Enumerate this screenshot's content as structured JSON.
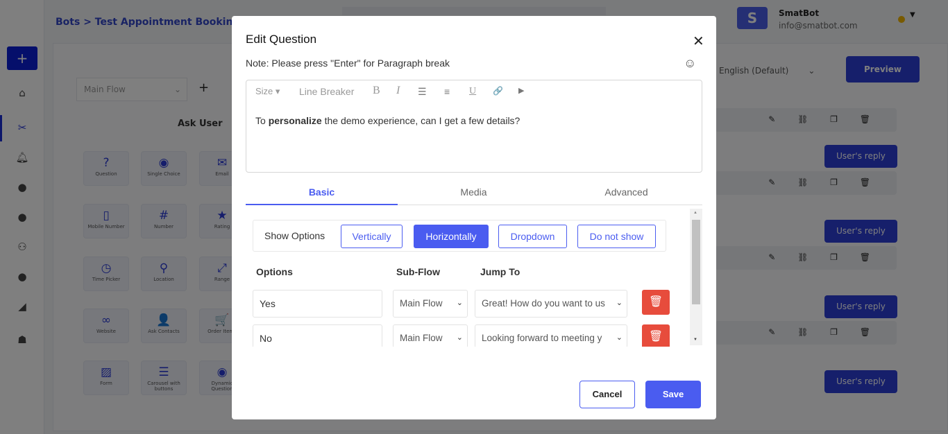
{
  "background": {
    "breadcrumb": "Bots > Test Appointment Booking > S",
    "flow_select": "Main Flow",
    "section_title": "Ask User",
    "tiles": [
      "Question",
      "Single Choice",
      "Email",
      "Mobile Number",
      "Number",
      "Rating",
      "Time Picker",
      "Location",
      "Range",
      "Website",
      "Ask Contacts",
      "Order Items",
      "Form",
      "Carousel with buttons",
      "Dynamic Question"
    ],
    "tile_icons": [
      "?",
      "◉",
      "✉",
      "▯",
      "#",
      "★",
      "◷",
      "⚲",
      "⤢",
      "∞",
      "👤",
      "🛒",
      "▨",
      "☰",
      "◉"
    ],
    "profile": {
      "initial": "S",
      "name": "SmatBot",
      "email": "info@smatbot.com"
    },
    "language": "English (Default)",
    "preview": "Preview",
    "reply_label": "User's reply",
    "row_icons": "✎ ⛓ ❐ 🗑"
  },
  "modal": {
    "title": "Edit Question",
    "note": "Note: Please press \"Enter\" for Paragraph break",
    "toolbar": {
      "size": "Size ▾",
      "line_breaker": "Line Breaker",
      "bold": "B",
      "italic": "I",
      "ul": "☰",
      "ol": "≡",
      "underline": "U",
      "link": "🔗",
      "video": "▶"
    },
    "text_pre": "To ",
    "text_bold": "personalize",
    "text_post": " the demo experience, can I get a few details?",
    "tabs": [
      "Basic",
      "Media",
      "Advanced"
    ],
    "active_tab": "Basic",
    "show_options_label": "Show Options",
    "show_options": [
      "Vertically",
      "Horizontally",
      "Dropdown",
      "Do not show"
    ],
    "selected_show_option": "Horizontally",
    "headers": {
      "options": "Options",
      "subflow": "Sub-Flow",
      "jump": "Jump To"
    },
    "rows": [
      {
        "option": "Yes",
        "subflow": "Main Flow",
        "jump": "Great! How do you want to us"
      },
      {
        "option": "No",
        "subflow": "Main Flow",
        "jump": "Looking forward to meeting y"
      }
    ],
    "cancel": "Cancel",
    "save": "Save"
  },
  "colors": {
    "accent": "#4a5cf0",
    "delete": "#e74c3c"
  }
}
